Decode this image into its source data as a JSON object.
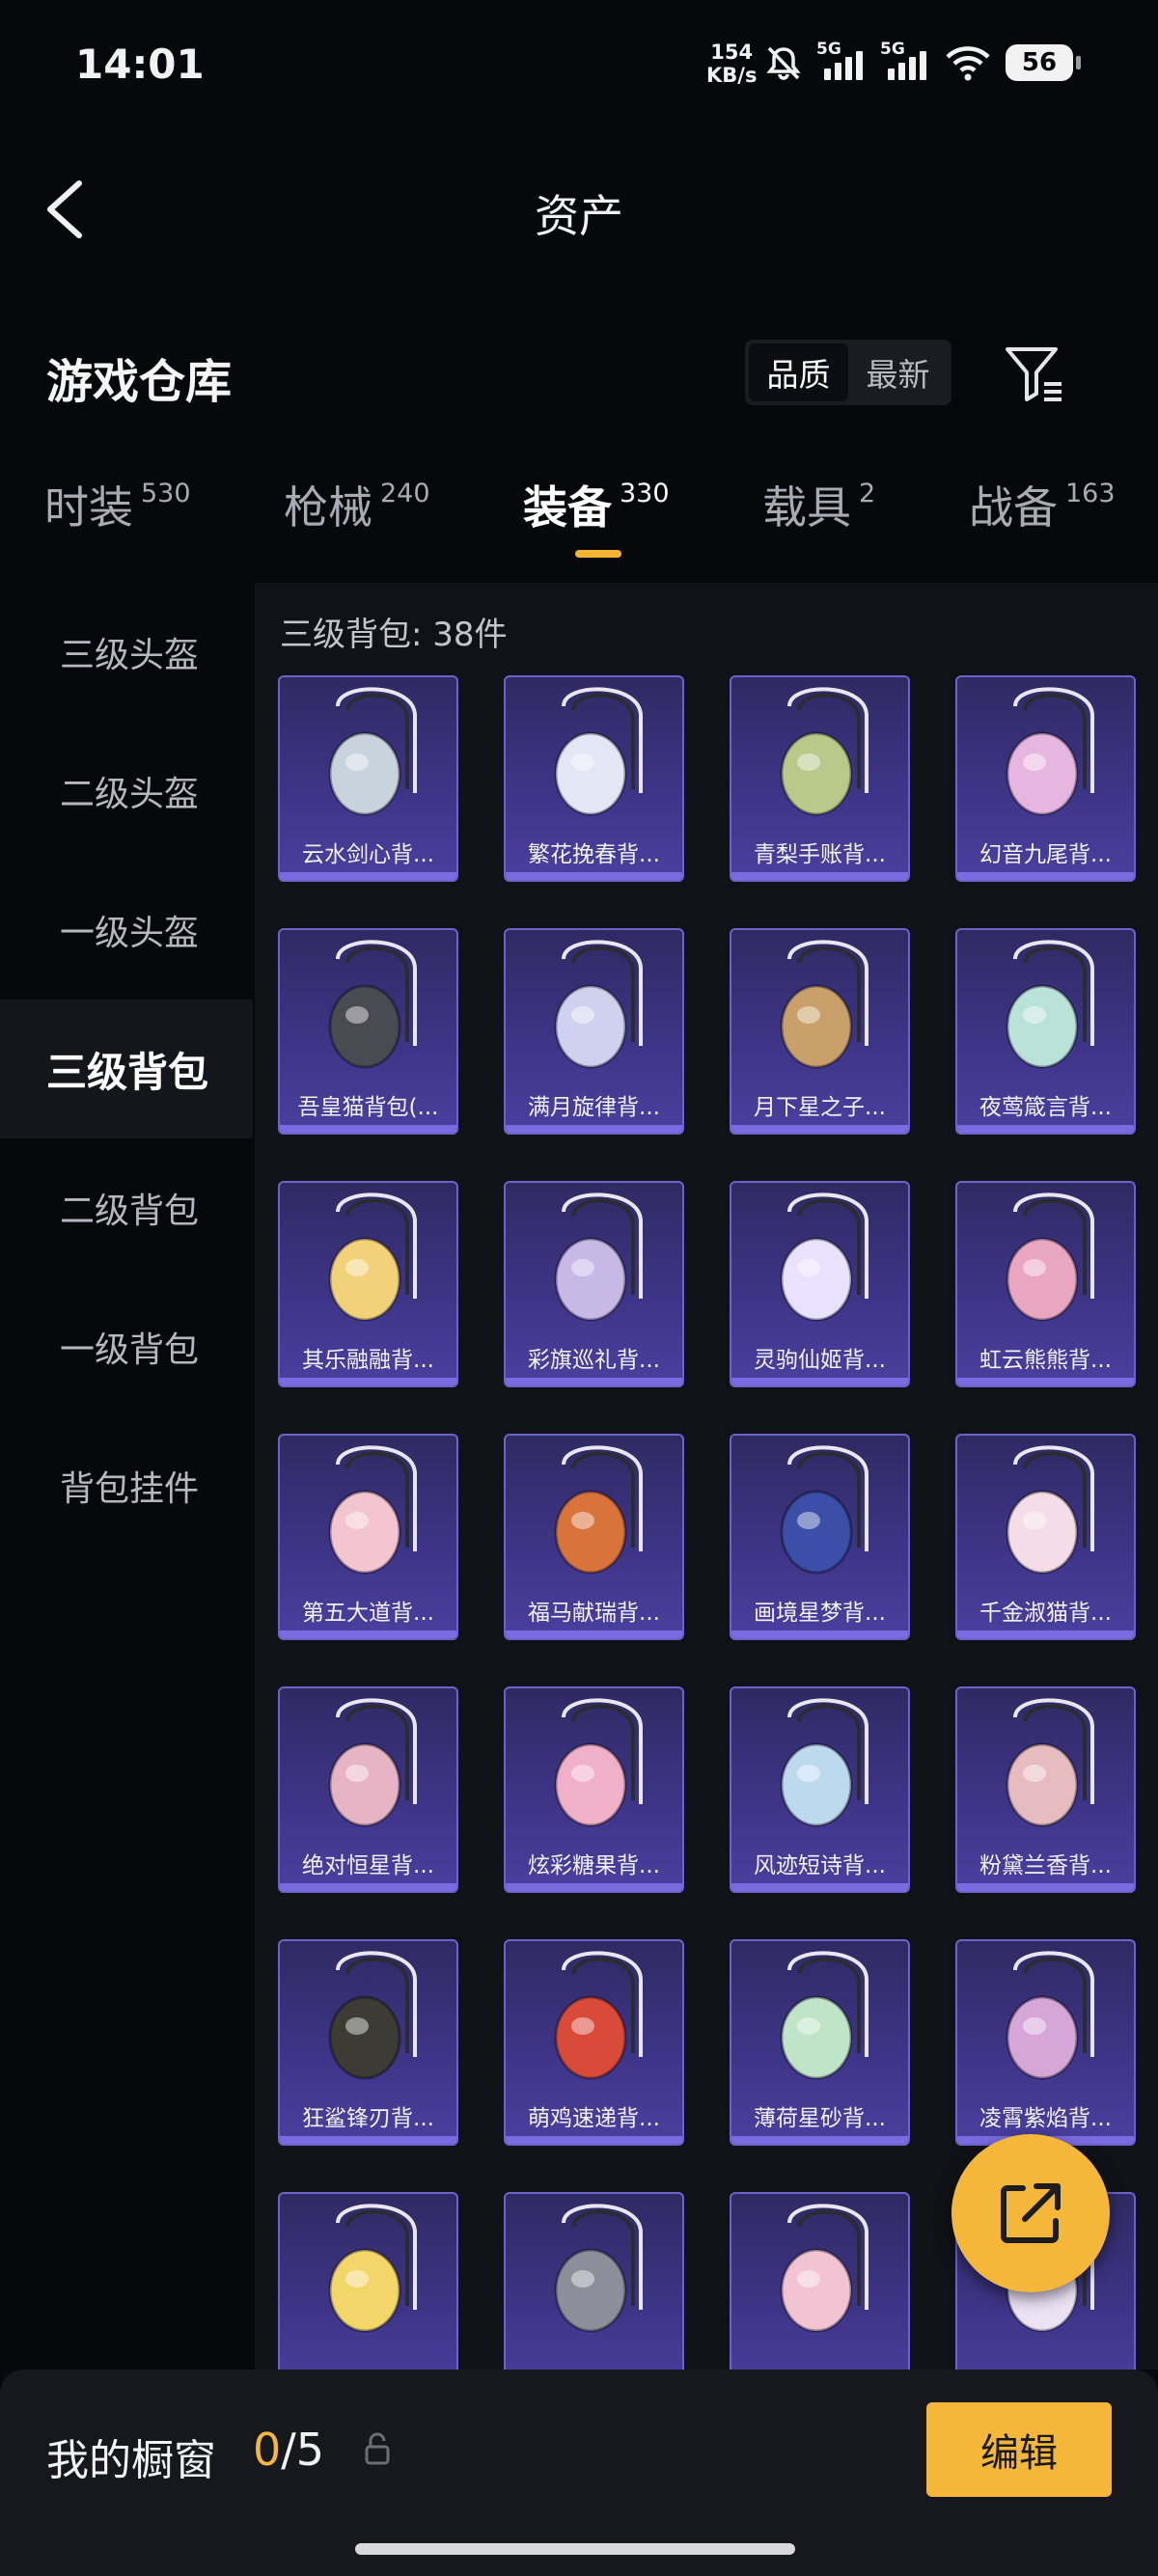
{
  "status_bar": {
    "time": "14:01",
    "net_speed": "154",
    "net_unit": "KB/s",
    "sim1": "5G",
    "sim2": "5G",
    "battery": "56"
  },
  "header": {
    "title": "资产"
  },
  "section": {
    "title": "游戏仓库",
    "sort_options": [
      "品质",
      "最新"
    ],
    "sort_active": "品质"
  },
  "tabs": [
    {
      "name": "时装",
      "count": "530"
    },
    {
      "name": "枪械",
      "count": "240"
    },
    {
      "name": "装备",
      "count": "330"
    },
    {
      "name": "载具",
      "count": "2"
    },
    {
      "name": "战备",
      "count": "163"
    }
  ],
  "active_tab": "装备",
  "sidebar": [
    {
      "label": "三级头盔"
    },
    {
      "label": "二级头盔"
    },
    {
      "label": "一级头盔"
    },
    {
      "label": "三级背包"
    },
    {
      "label": "二级背包"
    },
    {
      "label": "一级背包"
    },
    {
      "label": "背包挂件"
    }
  ],
  "active_sidebar": "三级背包",
  "content": {
    "heading": "三级背包: 38件",
    "items": [
      {
        "name": "云水剑心背...",
        "color": "#c9d3dd"
      },
      {
        "name": "繁花挽春背...",
        "color": "#e3e6f4"
      },
      {
        "name": "青梨手账背...",
        "color": "#b8c98a"
      },
      {
        "name": "幻音九尾背...",
        "color": "#e7b6e0"
      },
      {
        "name": "吾皇猫背包(...",
        "color": "#4a4a52"
      },
      {
        "name": "满月旋律背...",
        "color": "#cfd2ee"
      },
      {
        "name": "月下星之子...",
        "color": "#c9a06a"
      },
      {
        "name": "夜莺箴言背...",
        "color": "#b9e2d8"
      },
      {
        "name": "其乐融融背...",
        "color": "#f1d27a"
      },
      {
        "name": "彩旗巡礼背...",
        "color": "#c7b8e6"
      },
      {
        "name": "灵驹仙姬背...",
        "color": "#e9e2ff"
      },
      {
        "name": "虹云熊熊背...",
        "color": "#e9a6c1"
      },
      {
        "name": "第五大道背...",
        "color": "#f2c5d1"
      },
      {
        "name": "福马献瑞背...",
        "color": "#d9733c"
      },
      {
        "name": "画境星梦背...",
        "color": "#3b4fa8"
      },
      {
        "name": "千金淑猫背...",
        "color": "#f4dde6"
      },
      {
        "name": "绝对恒星背...",
        "color": "#e7b4c6"
      },
      {
        "name": "炫彩糖果背...",
        "color": "#f0b0c8"
      },
      {
        "name": "风迹短诗背...",
        "color": "#bcd9ee"
      },
      {
        "name": "粉黛兰香背...",
        "color": "#e7bcc0"
      },
      {
        "name": "狂鲨锋刃背...",
        "color": "#3c3c34"
      },
      {
        "name": "萌鸡速递背...",
        "color": "#d94a38"
      },
      {
        "name": "薄荷星砂背...",
        "color": "#bfe4c7"
      },
      {
        "name": "凌霄紫焰背...",
        "color": "#d6a6d8"
      },
      {
        "name": "",
        "color": "#f3d66a"
      },
      {
        "name": "",
        "color": "#8c8f9a"
      },
      {
        "name": "",
        "color": "#f1c3d3"
      },
      {
        "name": "",
        "color": "#ece2f4"
      }
    ]
  },
  "bottom_bar": {
    "label": "我的橱窗",
    "count_current": "0",
    "count_sep": "/",
    "count_total": "5",
    "edit_label": "编辑"
  },
  "colors": {
    "accent": "#f4b73a",
    "card": "#3e3486",
    "background": "#07080c"
  }
}
